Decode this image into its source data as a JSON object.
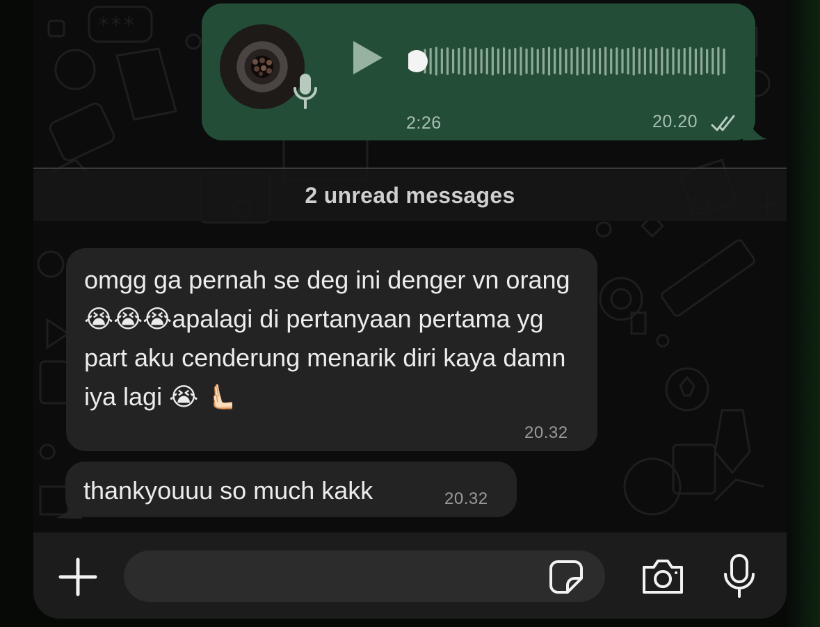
{
  "colors": {
    "background": "#0c0c0c",
    "outgoing_bubble": "#234d37",
    "incoming_bubble": "#232323",
    "composer_bar": "#1c1c1c",
    "input_field": "#2c2c2c"
  },
  "voice_note": {
    "duration": "2:26",
    "time": "20.20",
    "status": "read",
    "playback_progress": 0.0,
    "icons": [
      "avatar",
      "mic-icon",
      "play-icon",
      "waveform",
      "double-check-icon"
    ]
  },
  "unread_divider": {
    "label": "2 unread messages"
  },
  "messages": [
    {
      "text": "omgg ga pernah se deg ini denger vn orang 😭😭😭apalagi di pertanyaan pertama yg part aku cenderung menarik diri kaya damn iya lagi 😭 🫷🏻",
      "time": "20.32"
    },
    {
      "text": "thankyouuu so much kakk",
      "time": "20.32"
    }
  ],
  "composer": {
    "input_value": "",
    "icons": [
      "plus-icon",
      "sticker-icon",
      "camera-icon",
      "mic-icon"
    ]
  }
}
